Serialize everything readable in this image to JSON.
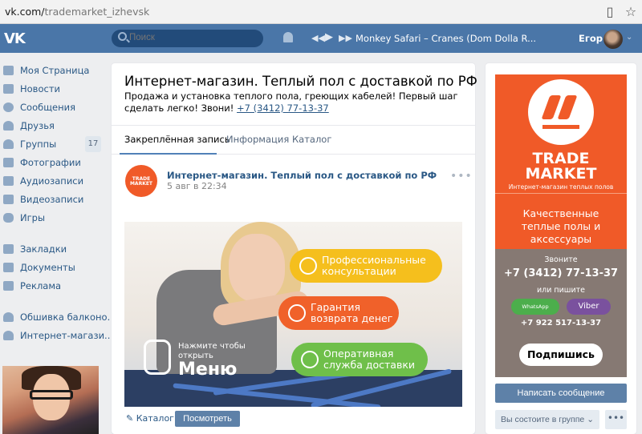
{
  "browser": {
    "url_domain": "vk.com/",
    "url_path": "trademarket_izhevsk"
  },
  "header": {
    "logo": "VK",
    "search_placeholder": "Поиск",
    "track": "Monkey Safari – Cranes (Dom Dolla R...",
    "user_name": "Егор"
  },
  "nav": {
    "items": [
      {
        "label": "Моя Страница"
      },
      {
        "label": "Новости"
      },
      {
        "label": "Сообщения"
      },
      {
        "label": "Друзья"
      },
      {
        "label": "Группы",
        "badge": "17"
      },
      {
        "label": "Фотографии"
      },
      {
        "label": "Аудиозаписи"
      },
      {
        "label": "Видеозаписи"
      },
      {
        "label": "Игры"
      },
      {
        "label": "Закладки"
      },
      {
        "label": "Документы"
      },
      {
        "label": "Реклама"
      },
      {
        "label": "Обшивка балконо.."
      },
      {
        "label": "Интернет-магази.."
      }
    ]
  },
  "group": {
    "title": "Интернет-магазин. Теплый пол с доставкой по РФ",
    "status": "Продажа и установка теплого пола, греющих кабелей! Первый шаг сделать легко! Звони!",
    "phone": "+7 (3412) 77-13-37",
    "tabs": [
      "Закреплённая запись",
      "Информация",
      "Каталог"
    ]
  },
  "post": {
    "avatar_text": "TRADE MARKET",
    "author": "Интернет-магазин. Теплый пол с доставкой по РФ",
    "date": "5 авг в 22:34",
    "menu": "•••",
    "banner": {
      "pill1": "Профессиональные консультации",
      "pill2": "Гарантия возврата денег",
      "pill3": "Оперативная служба доставки",
      "hint": "Нажмите чтобы открыть",
      "menu_word": "Меню"
    },
    "catalog_link": "Каталог",
    "view_button": "Посмотреть"
  },
  "promo": {
    "brand": "TRADE MARKET",
    "subtitle": "Интернет-магазин теплых полов",
    "slogan": "Качественные теплые полы и аксессуары",
    "call": "Звоните",
    "phone": "+7 (3412) 77-13-37",
    "or_write": "или пишите",
    "whatsapp": "WhatsApp",
    "viber": "Viber",
    "phone2": "+7 922 517-13-37",
    "subscribe": "Подпишись"
  },
  "actions": {
    "write": "Написать сообщение",
    "member": "Вы состоите в группе",
    "more": "•••"
  },
  "colors": {
    "vk_blue": "#4a76a8",
    "brand_orange": "#f05a28",
    "link": "#2a5885"
  }
}
